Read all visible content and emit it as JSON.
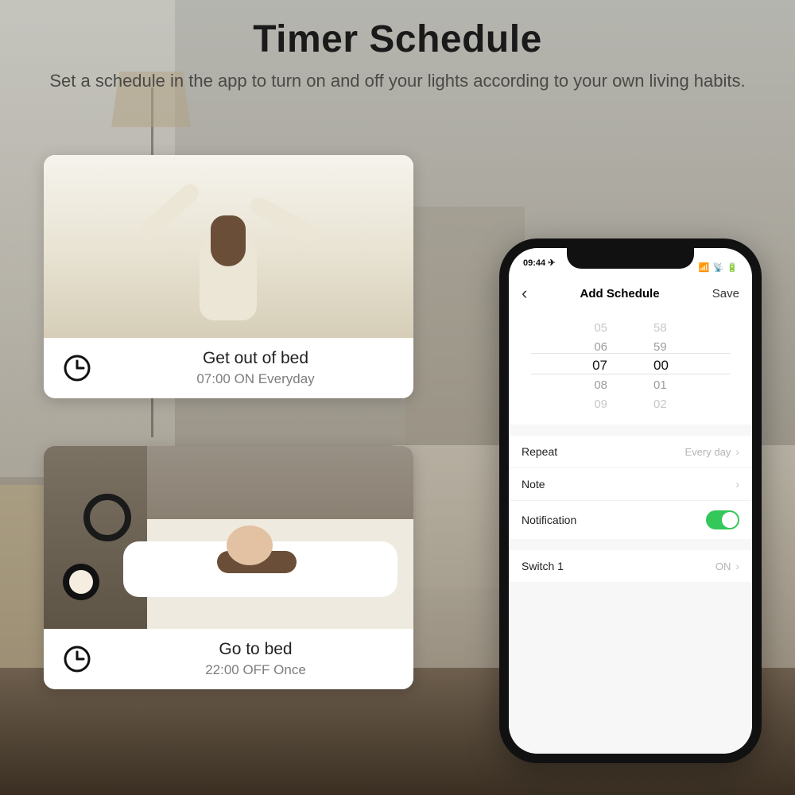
{
  "headline": {
    "title": "Timer Schedule",
    "subtitle": "Set a schedule in the app to turn on and off your lights according to your own living habits."
  },
  "cards": [
    {
      "title": "Get out of bed",
      "subtitle": "07:00 ON Everyday"
    },
    {
      "title": "Go to bed",
      "subtitle": "22:00 OFF Once"
    }
  ],
  "phone": {
    "status": {
      "time": "09:44"
    },
    "nav": {
      "title": "Add Schedule",
      "save": "Save"
    },
    "picker": {
      "rows": [
        {
          "h": "05",
          "m": "58"
        },
        {
          "h": "06",
          "m": "59"
        },
        {
          "h": "07",
          "m": "00"
        },
        {
          "h": "08",
          "m": "01"
        },
        {
          "h": "09",
          "m": "02"
        }
      ]
    },
    "settings": {
      "repeat": {
        "label": "Repeat",
        "value": "Every day"
      },
      "note": {
        "label": "Note",
        "value": ""
      },
      "notification": {
        "label": "Notification",
        "on": true
      },
      "switch1": {
        "label": "Switch 1",
        "value": "ON"
      }
    }
  }
}
